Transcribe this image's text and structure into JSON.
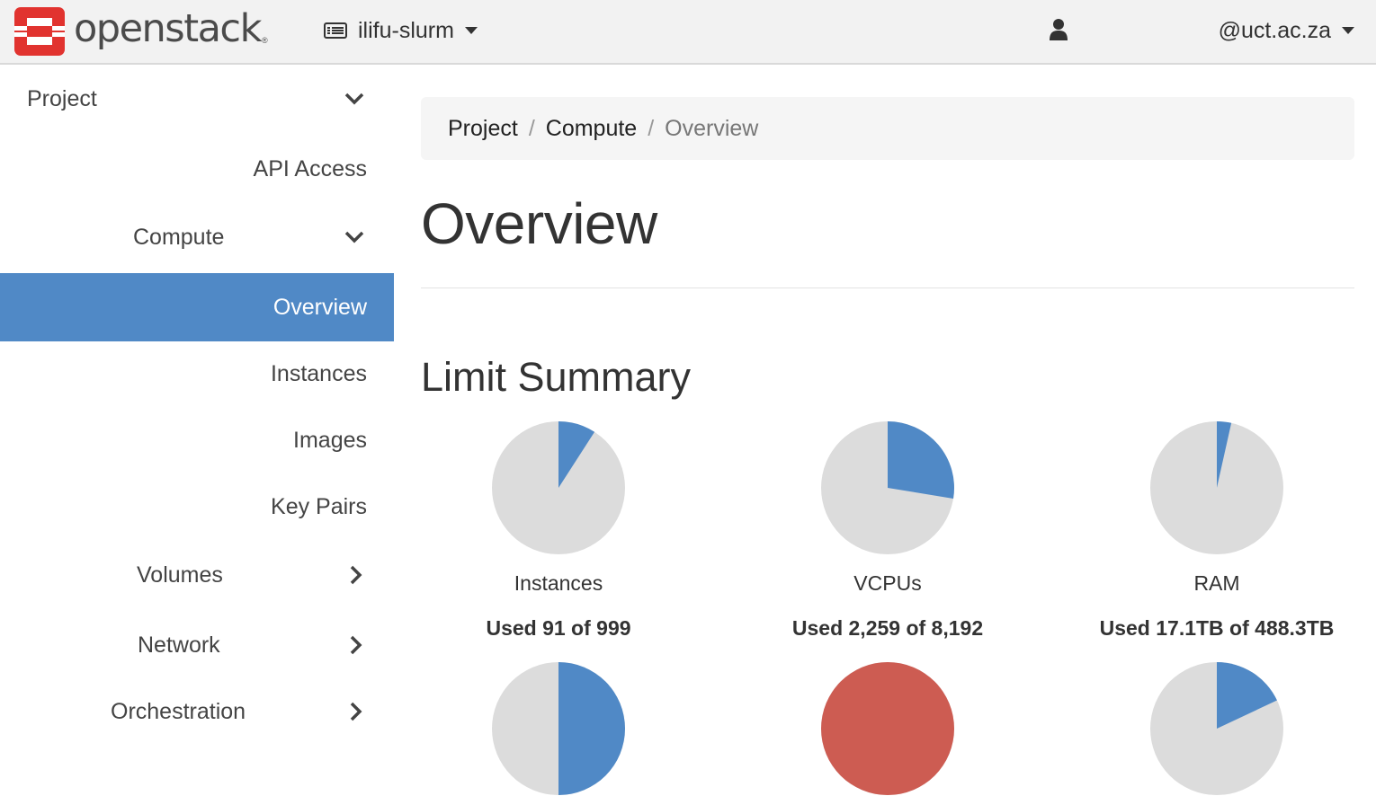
{
  "brand": {
    "name": "openstack",
    "reg": "®",
    "logo_color": "#e1332f"
  },
  "header": {
    "project": "ilifu-slurm",
    "user": "@uct.ac.za"
  },
  "sidebar": {
    "items": [
      {
        "label": "Project",
        "chevron": "down"
      },
      {
        "label": "API Access"
      },
      {
        "label": "Compute",
        "chevron": "down"
      },
      {
        "label": "Overview",
        "active": true
      },
      {
        "label": "Instances"
      },
      {
        "label": "Images"
      },
      {
        "label": "Key Pairs"
      },
      {
        "label": "Volumes",
        "chevron": "right"
      },
      {
        "label": "Network",
        "chevron": "right"
      },
      {
        "label": "Orchestration",
        "chevron": "right"
      }
    ],
    "active_color": "#5089c6"
  },
  "breadcrumb": {
    "items": [
      "Project",
      "Compute"
    ],
    "current": "Overview"
  },
  "page": {
    "title": "Overview",
    "section": "Limit Summary"
  },
  "colors": {
    "used": "#5089c6",
    "free": "#dcdcdc",
    "over": "#cd5c52"
  },
  "chart_data": {
    "type": "pie",
    "charts": [
      {
        "name": "Instances",
        "used_text": "Used 91 of 999",
        "fraction": 0.0911
      },
      {
        "name": "VCPUs",
        "used_text": "Used 2,259 of 8,192",
        "fraction": 0.2758
      },
      {
        "name": "RAM",
        "used_text": "Used 17.1TB of 488.3TB",
        "fraction": 0.035
      },
      {
        "name": "",
        "used_text": "",
        "fraction": 0.5
      },
      {
        "name": "",
        "used_text": "",
        "fraction": 1.0,
        "color": "over"
      },
      {
        "name": "",
        "used_text": "",
        "fraction": 0.18
      }
    ]
  }
}
